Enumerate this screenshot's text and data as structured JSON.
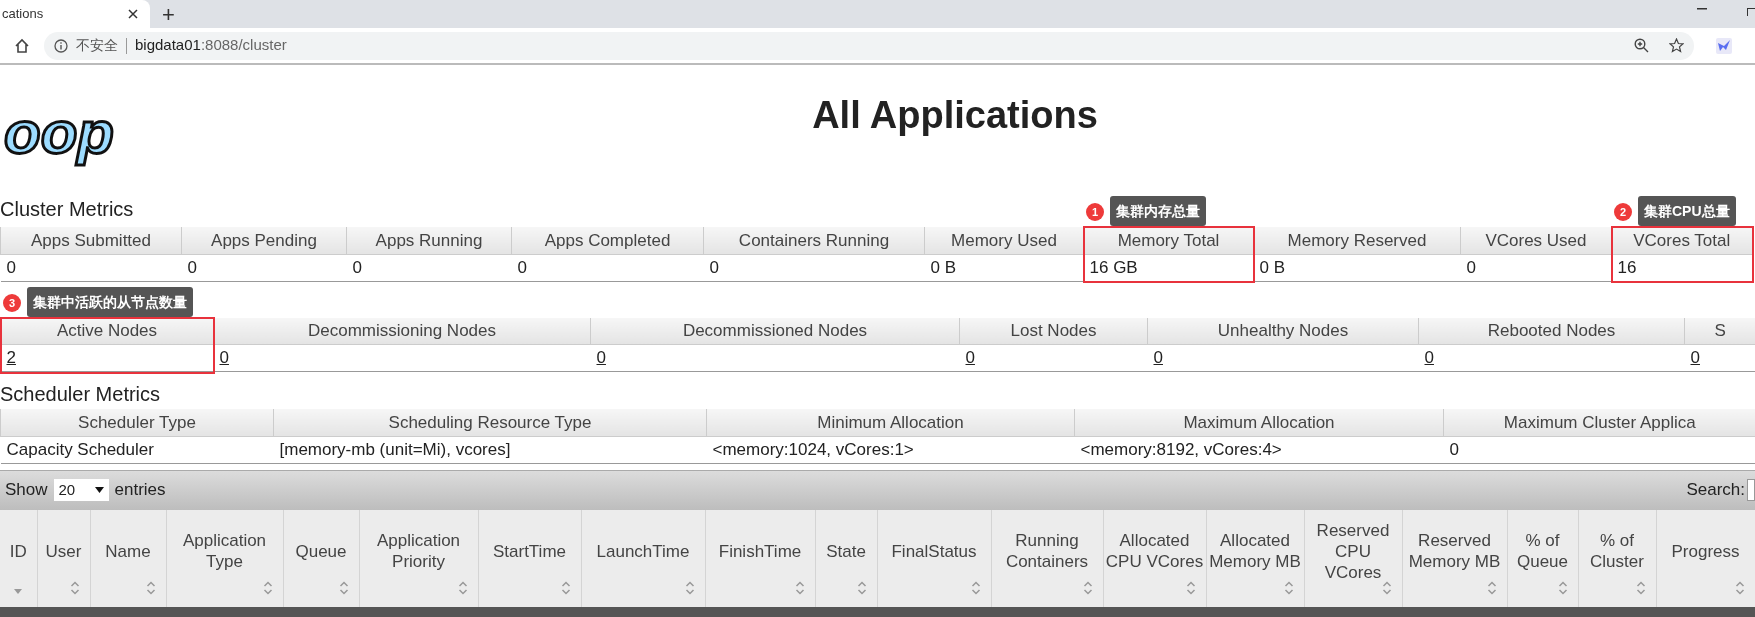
{
  "browser": {
    "tab_title": "cations",
    "new_tab": "+",
    "security_label": "不安全",
    "url_host": "bigdata01",
    "url_rest": ":8088/cluster"
  },
  "header": {
    "logo_text": "oop",
    "title": "All Applications"
  },
  "cluster_metrics": {
    "title": "Cluster Metrics",
    "columns": [
      {
        "label": "Apps Submitted",
        "value": "0",
        "highlighted": false
      },
      {
        "label": "Apps Pending",
        "value": "0",
        "highlighted": false
      },
      {
        "label": "Apps Running",
        "value": "0",
        "highlighted": false
      },
      {
        "label": "Apps Completed",
        "value": "0",
        "highlighted": false
      },
      {
        "label": "Containers Running",
        "value": "0",
        "highlighted": false
      },
      {
        "label": "Memory Used",
        "value": "0 B",
        "highlighted": false
      },
      {
        "label": "Memory Total",
        "value": "16 GB",
        "highlighted": true,
        "callout": {
          "number": "1",
          "text": "集群内存总量"
        }
      },
      {
        "label": "Memory Reserved",
        "value": "0 B",
        "highlighted": false
      },
      {
        "label": "VCores Used",
        "value": "0",
        "highlighted": false
      },
      {
        "label": "VCores Total",
        "value": "16",
        "highlighted": true,
        "callout": {
          "number": "2",
          "text": "集群CPU总量"
        }
      }
    ]
  },
  "node_metrics": {
    "columns": [
      {
        "label": "Active Nodes",
        "value": "2",
        "highlighted": true,
        "callout": {
          "number": "3",
          "text": "集群中活跃的从节点数量"
        }
      },
      {
        "label": "Decommissioning Nodes",
        "value": "0",
        "highlighted": false
      },
      {
        "label": "Decommissioned Nodes",
        "value": "0",
        "highlighted": false
      },
      {
        "label": "Lost Nodes",
        "value": "0",
        "highlighted": false
      },
      {
        "label": "Unhealthy Nodes",
        "value": "0",
        "highlighted": false
      },
      {
        "label": "Rebooted Nodes",
        "value": "0",
        "highlighted": false
      },
      {
        "label": "S",
        "value": "0",
        "highlighted": false
      }
    ]
  },
  "scheduler_metrics": {
    "title": "Scheduler Metrics",
    "columns": [
      {
        "label": "Scheduler Type",
        "value": "Capacity Scheduler"
      },
      {
        "label": "Scheduling Resource Type",
        "value": "[memory-mb (unit=Mi), vcores]"
      },
      {
        "label": "Minimum Allocation",
        "value": "<memory:1024, vCores:1>"
      },
      {
        "label": "Maximum Allocation",
        "value": "<memory:8192, vCores:4>"
      },
      {
        "label": "Maximum Cluster Applica",
        "value": "0"
      }
    ]
  },
  "applications": {
    "show_label": "Show",
    "page_size": "20",
    "entries_label": "entries",
    "search_label": "Search:",
    "columns": [
      {
        "label": "ID",
        "sorted": true
      },
      {
        "label": "User",
        "sorted": false
      },
      {
        "label": "Name",
        "sorted": false
      },
      {
        "label": "Application Type",
        "sorted": false
      },
      {
        "label": "Queue",
        "sorted": false
      },
      {
        "label": "Application Priority",
        "sorted": false
      },
      {
        "label": "StartTime",
        "sorted": false
      },
      {
        "label": "LaunchTime",
        "sorted": false
      },
      {
        "label": "FinishTime",
        "sorted": false
      },
      {
        "label": "State",
        "sorted": false
      },
      {
        "label": "FinalStatus",
        "sorted": false
      },
      {
        "label": "Running Containers",
        "sorted": false
      },
      {
        "label": "Allocated CPU VCores",
        "sorted": false
      },
      {
        "label": "Allocated Memory MB",
        "sorted": false
      },
      {
        "label": "Reserved CPU VCores",
        "sorted": false
      },
      {
        "label": "Reserved Memory MB",
        "sorted": false
      },
      {
        "label": "% of Queue",
        "sorted": false
      },
      {
        "label": "% of Cluster",
        "sorted": false
      },
      {
        "label": "Progress",
        "sorted": false
      }
    ]
  }
}
